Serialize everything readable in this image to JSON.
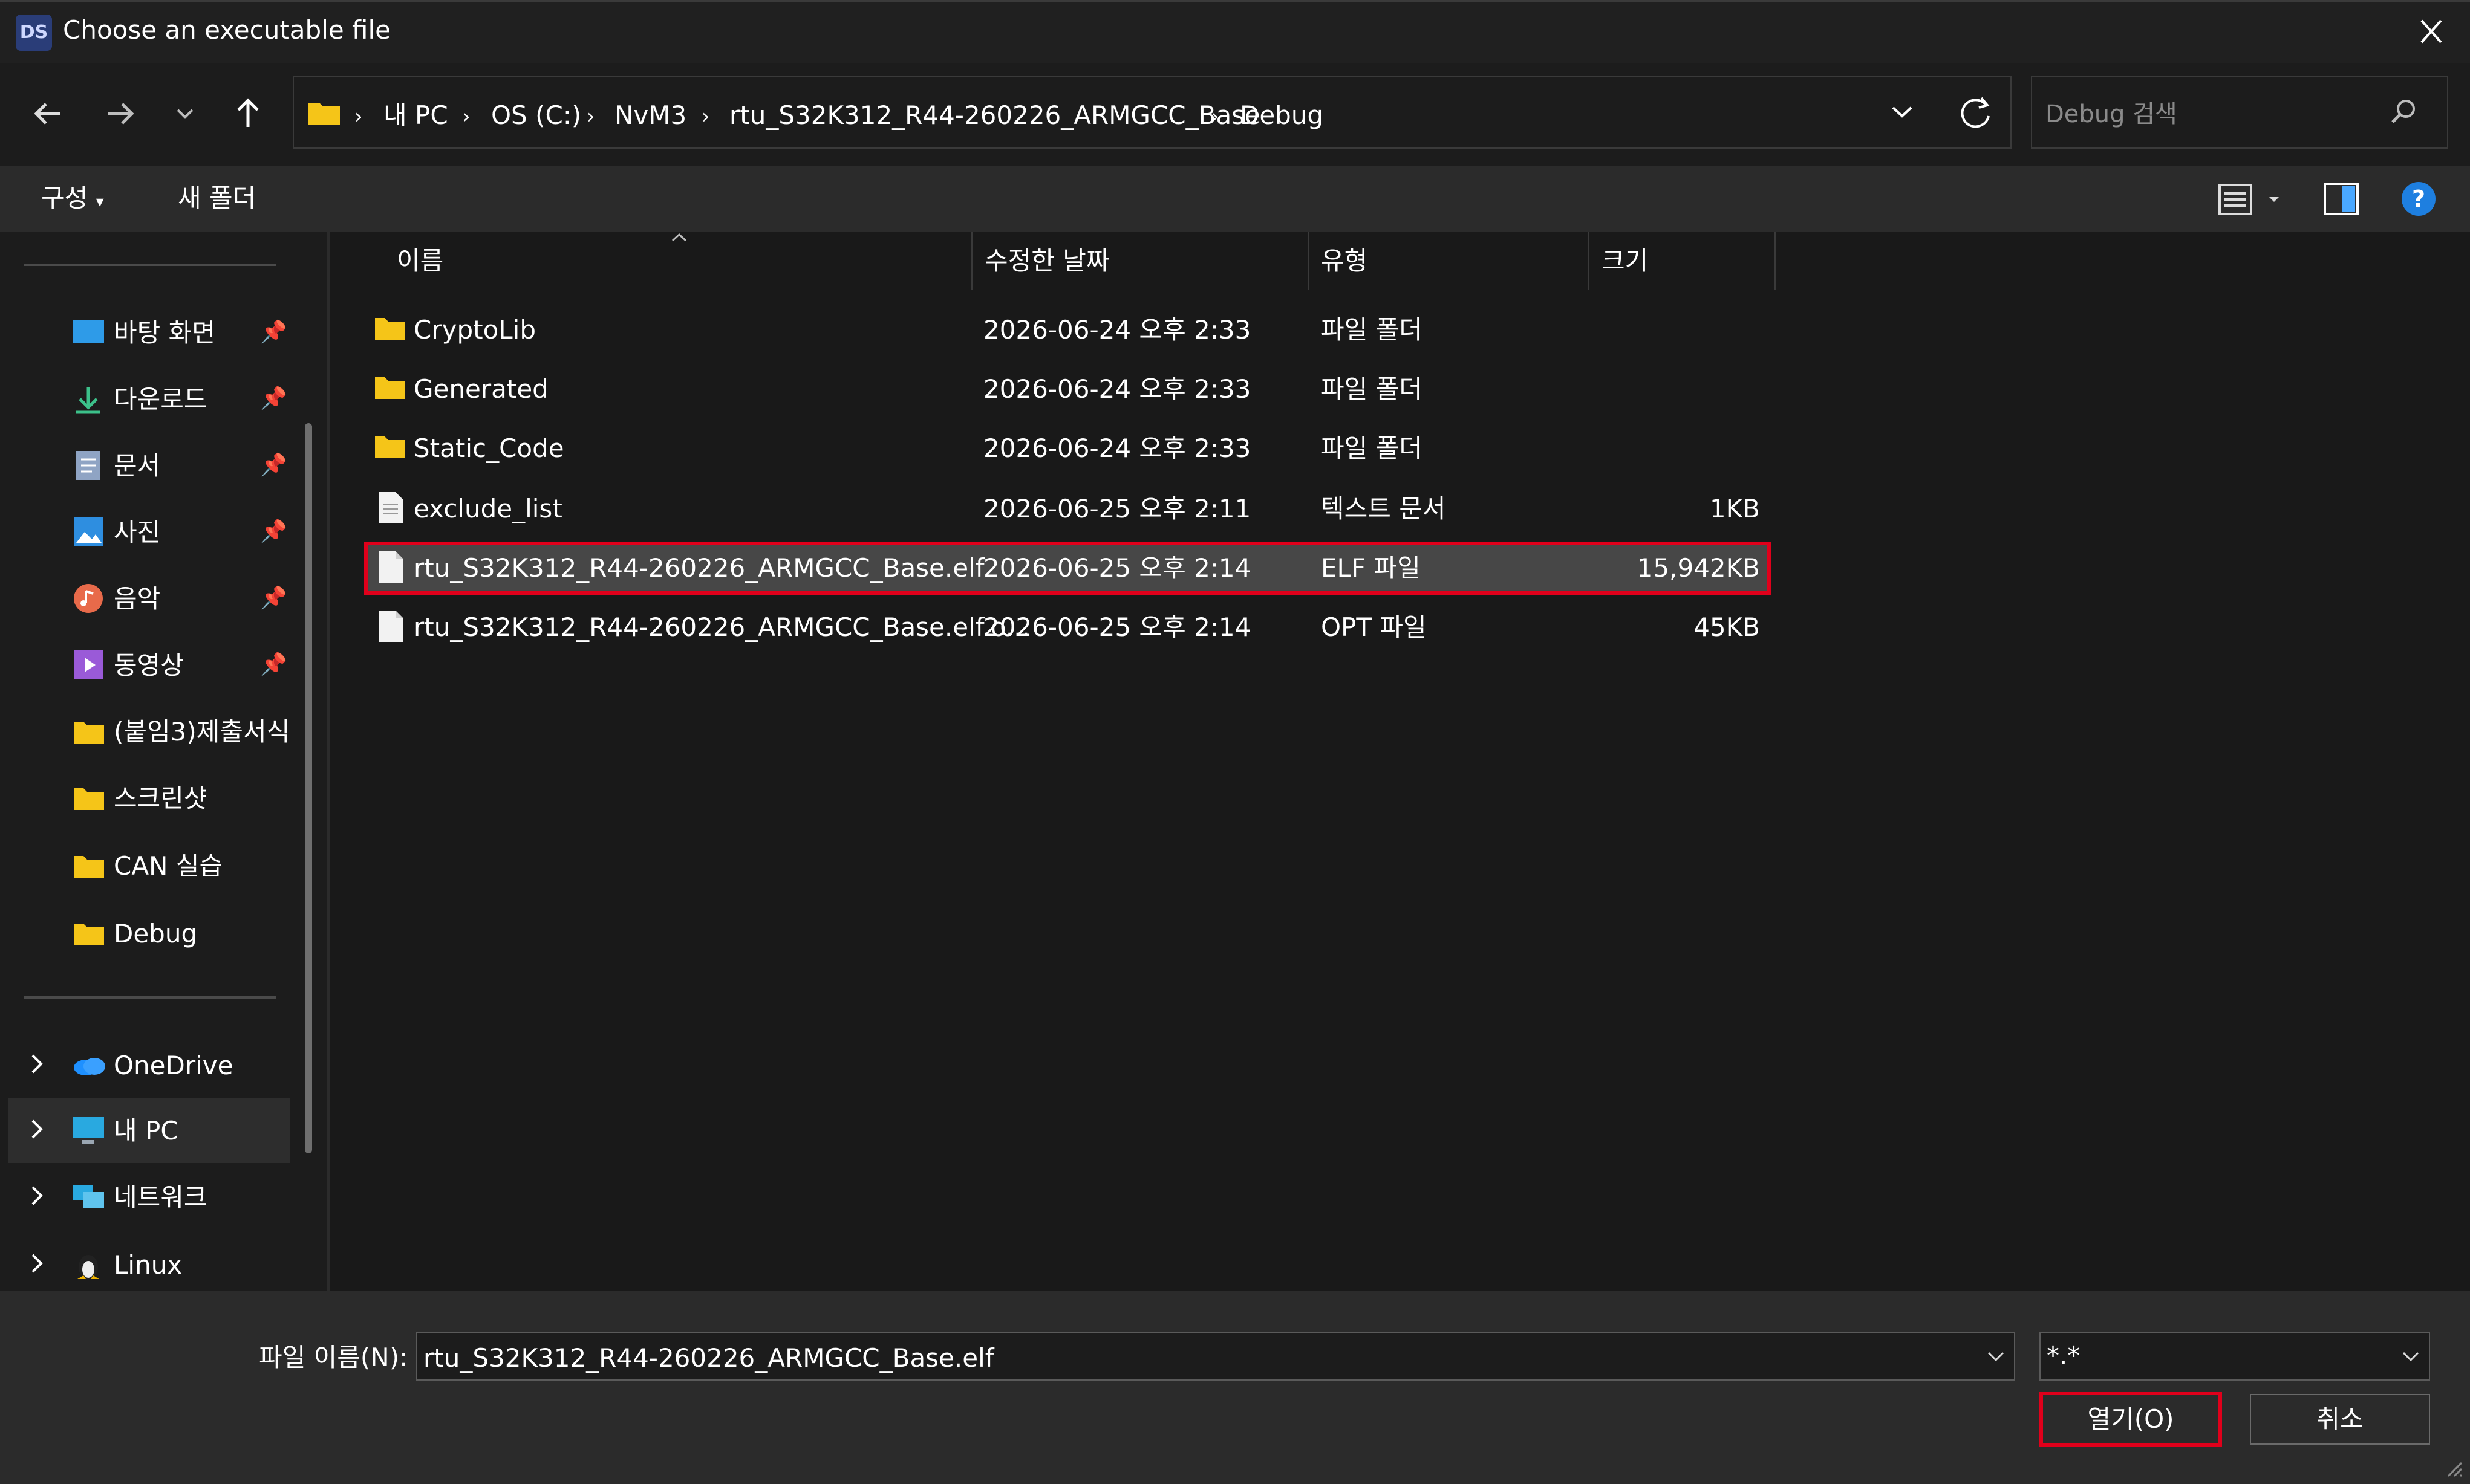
{
  "window": {
    "title": "Choose an executable file",
    "app_icon_text": "DS"
  },
  "nav": {
    "breadcrumbs": [
      "내 PC",
      "OS (C:)",
      "NvM3",
      "rtu_S32K312_R44-260226_ARMGCC_Base",
      "Debug"
    ],
    "search_placeholder": "Debug 검색"
  },
  "toolbar": {
    "organize_label": "구성",
    "new_folder_label": "새 폴더",
    "help_label": "?"
  },
  "sidebar": {
    "quick_access": [
      {
        "label": "바탕 화면",
        "icon": "desktop-icon",
        "pinned": true
      },
      {
        "label": "다운로드",
        "icon": "download-icon",
        "pinned": true
      },
      {
        "label": "문서",
        "icon": "documents-icon",
        "pinned": true
      },
      {
        "label": "사진",
        "icon": "pictures-icon",
        "pinned": true
      },
      {
        "label": "음악",
        "icon": "music-icon",
        "pinned": true
      },
      {
        "label": "동영상",
        "icon": "videos-icon",
        "pinned": true
      },
      {
        "label": "(붙임3)제출서식",
        "icon": "folder-icon",
        "pinned": false
      },
      {
        "label": "스크린샷",
        "icon": "folder-icon",
        "pinned": false
      },
      {
        "label": "CAN 실습",
        "icon": "folder-icon",
        "pinned": false
      },
      {
        "label": "Debug",
        "icon": "folder-icon",
        "pinned": false
      }
    ],
    "tree": [
      {
        "label": "OneDrive",
        "icon": "onedrive-icon"
      },
      {
        "label": "내 PC",
        "icon": "pc-icon"
      },
      {
        "label": "네트워크",
        "icon": "network-icon"
      },
      {
        "label": "Linux",
        "icon": "linux-icon"
      }
    ]
  },
  "columns": {
    "name": "이름",
    "modified": "수정한 날짜",
    "type": "유형",
    "size": "크기"
  },
  "files": [
    {
      "name": "CryptoLib",
      "modified": "2026-06-24 오후 2:33",
      "type": "파일 폴더",
      "size": "",
      "icon": "folder-icon"
    },
    {
      "name": "Generated",
      "modified": "2026-06-24 오후 2:33",
      "type": "파일 폴더",
      "size": "",
      "icon": "folder-icon"
    },
    {
      "name": "Static_Code",
      "modified": "2026-06-24 오후 2:33",
      "type": "파일 폴더",
      "size": "",
      "icon": "folder-icon"
    },
    {
      "name": "exclude_list",
      "modified": "2026-06-25 오후 2:11",
      "type": "텍스트 문서",
      "size": "1KB",
      "icon": "text-file-icon"
    },
    {
      "name": "rtu_S32K312_R44-260226_ARMGCC_Base.elf",
      "modified": "2026-06-25 오후 2:14",
      "type": "ELF 파일",
      "size": "15,942KB",
      "icon": "file-icon",
      "selected": true
    },
    {
      "name": "rtu_S32K312_R44-260226_ARMGCC_Base.elf.o...",
      "modified": "2026-06-25 오후 2:14",
      "type": "OPT 파일",
      "size": "45KB",
      "icon": "file-icon"
    }
  ],
  "bottom": {
    "filename_label": "파일 이름(N):",
    "filename_value": "rtu_S32K312_R44-260226_ARMGCC_Base.elf",
    "filter_value": "*.*",
    "open_label": "열기(O)",
    "cancel_label": "취소"
  },
  "colors": {
    "highlight_outline": "#e0001b",
    "folder": "#f5c518",
    "help": "#1e7fe0"
  }
}
